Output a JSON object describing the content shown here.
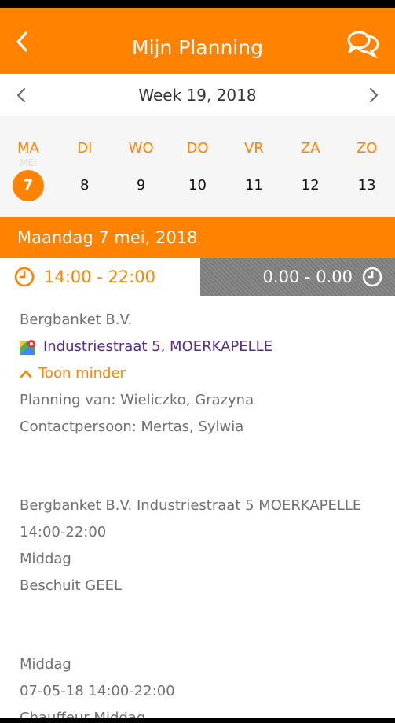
{
  "header": {
    "title": "Mijn Planning",
    "background_color": "#ff8200"
  },
  "week": {
    "label": "Week 19, 2018"
  },
  "days": [
    {
      "abbr": "MA",
      "num": "7",
      "month": "MEI",
      "selected": true
    },
    {
      "abbr": "DI",
      "num": "8"
    },
    {
      "abbr": "WO",
      "num": "9"
    },
    {
      "abbr": "DO",
      "num": "10"
    },
    {
      "abbr": "VR",
      "num": "11"
    },
    {
      "abbr": "ZA",
      "num": "12"
    },
    {
      "abbr": "ZO",
      "num": "13"
    }
  ],
  "selected_date": "Maandag 7 mei, 2018",
  "times": {
    "planned": "14:00 - 22:00",
    "actual": "0.00 - 0.00"
  },
  "details": {
    "company": "Bergbanket B.V.",
    "address": "Industriestraat 5, MOERKAPELLE",
    "toggle_label": "Toon minder",
    "planner": "Planning van: Wieliczko, Grazyna",
    "contact": "Contactpersoon: Mertas, Sylwia"
  },
  "notes_block_1": [
    "Bergbanket B.V. Industriestraat 5 MOERKAPELLE",
    "14:00-22:00",
    "Middag",
    "Beschuit GEEL"
  ],
  "notes_block_2": [
    "Middag",
    "07-05-18 14:00-22:00",
    "Chauffeur Middag"
  ]
}
